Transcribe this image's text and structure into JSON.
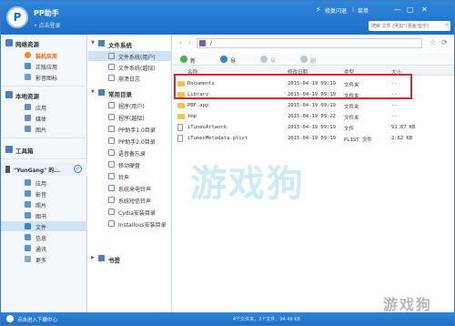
{
  "app": {
    "title": "PP助手",
    "subtitle": "• 点击登录",
    "logo_text": "P"
  },
  "titlebar": {
    "feedback": "修复闪退",
    "menu": "菜单",
    "search_placeholder": "搜索 文件 (例如*/漫画/音乐)"
  },
  "sidebar": {
    "sections": [
      {
        "title": "网络资源",
        "items": [
          {
            "label": "装机应用",
            "style": "orange"
          },
          {
            "label": "正版应用"
          },
          {
            "label": "影音图标"
          }
        ]
      },
      {
        "title": "本地资源",
        "items": [
          {
            "label": "应用"
          },
          {
            "label": "媒体"
          },
          {
            "label": "图片"
          }
        ]
      },
      {
        "title": "工具箱"
      }
    ],
    "device": {
      "name": "\"YunGang\" 的...",
      "items": [
        {
          "label": "应用"
        },
        {
          "label": "影音"
        },
        {
          "label": "照片"
        },
        {
          "label": "图书"
        },
        {
          "label": "文件",
          "active": true
        },
        {
          "label": "信息"
        },
        {
          "label": "通讯"
        },
        {
          "label": "更多"
        }
      ]
    }
  },
  "tree": {
    "fs_title": "文件系统",
    "fs_items": [
      {
        "label": "文件系统(用户)",
        "active": true
      },
      {
        "label": "文件系统(越狱)"
      },
      {
        "label": "崩溃日志"
      }
    ],
    "common_title": "常用目录",
    "common_items": [
      {
        "label": "程序(用户)"
      },
      {
        "label": "程序(越狱)"
      },
      {
        "label": "PP助手1.0目录"
      },
      {
        "label": "PP助手2.0目录"
      },
      {
        "label": "语音备忘录"
      },
      {
        "label": "移动硬盘"
      },
      {
        "label": "铃声"
      },
      {
        "label": "系统来电铃声"
      },
      {
        "label": "系统短信铃声"
      },
      {
        "label": "Cydia安装目录"
      },
      {
        "label": "Installous安装目录"
      }
    ],
    "bookmark_title": "书签"
  },
  "main": {
    "path": "/",
    "toolbar": {
      "new": "新建",
      "import": "导入",
      "export": "导出",
      "delete": "删除"
    },
    "columns": {
      "name": "名称",
      "modified": "修改日期",
      "type": "类型",
      "size": "大小"
    },
    "rows": [
      {
        "name": "Documents",
        "modified": "2015-04-19 09:19",
        "type": "文件夹",
        "size": "--",
        "kind": "folder"
      },
      {
        "name": "Library",
        "modified": "2015-04-19 09:19",
        "type": "文件夹",
        "size": "--",
        "kind": "folder"
      },
      {
        "name": "PBF.app",
        "modified": "2015-04-19 09:19",
        "type": "文件夹",
        "size": "--",
        "kind": "folder"
      },
      {
        "name": "tmp",
        "modified": "2015-04-19 09:22",
        "type": "文件夹",
        "size": "--",
        "kind": "folder"
      },
      {
        "name": "iTunesArtwork",
        "modified": "2015-04-19 09:19",
        "type": "文件",
        "size": "91.87 KB",
        "kind": "file"
      },
      {
        "name": "iTunesMetadata.plist",
        "modified": "2015-04-19 09:19",
        "type": "PLIST 文件",
        "size": "2.62 KB",
        "kind": "file"
      }
    ]
  },
  "watermark": {
    "text": "游戏狗",
    "corner_text": "游戏狗"
  },
  "statusbar": {
    "download": "点击进入下载中心",
    "summary": "4个文件夹，2个文件，94.49 KB"
  },
  "colors": {
    "brand": "#1d6fc7",
    "highlight": "#e0242a",
    "accent": "#e06a1a"
  }
}
